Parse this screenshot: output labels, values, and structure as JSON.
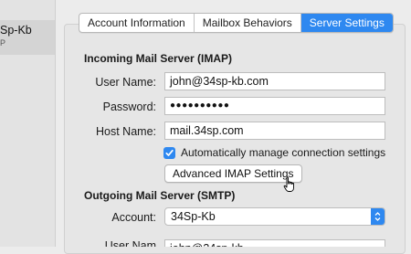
{
  "sidebar": {
    "account_name": "Sp-Kb",
    "account_sub": "P"
  },
  "tabs": [
    {
      "label": "Account Information",
      "selected": false
    },
    {
      "label": "Mailbox Behaviors",
      "selected": false
    },
    {
      "label": "Server Settings",
      "selected": true
    }
  ],
  "incoming": {
    "title": "Incoming Mail Server (IMAP)",
    "user_name_label": "User Name:",
    "user_name_value": "john@34sp-kb.com",
    "password_label": "Password:",
    "password_value": "●●●●●●●●●●",
    "host_name_label": "Host Name:",
    "host_name_value": "mail.34sp.com",
    "auto_manage_label": "Automatically manage connection settings",
    "auto_manage_checked": true,
    "advanced_button": "Advanced IMAP Settings"
  },
  "outgoing": {
    "title": "Outgoing Mail Server (SMTP)",
    "account_label": "Account:",
    "account_value": "34Sp-Kb",
    "partial_label": "User Nam",
    "partial_value": "john@34sp-kb"
  },
  "colors": {
    "accent": "#2e88f0",
    "background": "#ececec"
  }
}
